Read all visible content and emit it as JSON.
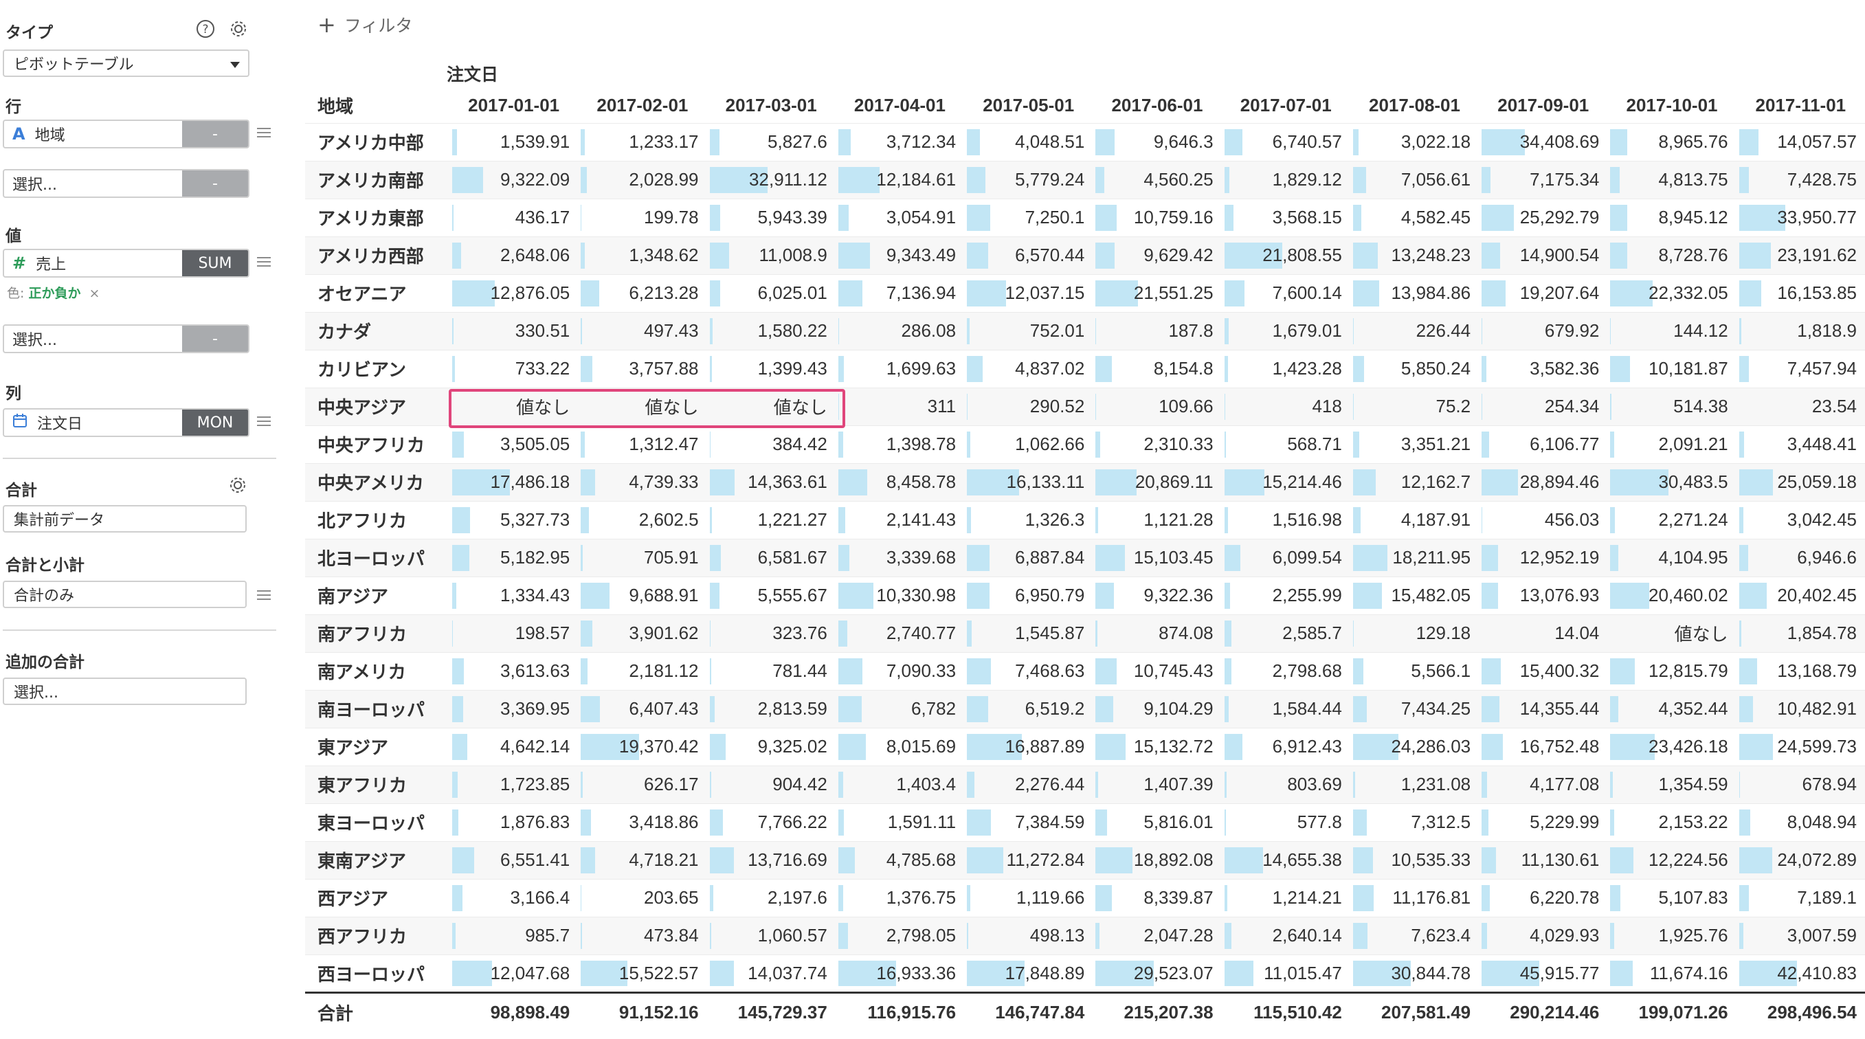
{
  "sidebar": {
    "type": {
      "title": "タイプ",
      "value": "ピボットテーブル"
    },
    "rows": {
      "title": "行",
      "field": "地域",
      "agg": "-",
      "select_placeholder": "選択...",
      "select_agg": "-"
    },
    "values": {
      "title": "値",
      "field": "売上",
      "agg": "SUM",
      "color_prefix": "色:",
      "color_value": "正か負か",
      "color_remove": "×",
      "select_placeholder": "選択...",
      "select_agg": "-"
    },
    "columns": {
      "title": "列",
      "field": "注文日",
      "agg": "MON"
    },
    "total": {
      "title": "合計",
      "value": "集計前データ"
    },
    "subtotal": {
      "title": "合計と小計",
      "value": "合計のみ"
    },
    "extra": {
      "title": "追加の合計",
      "placeholder": "選択..."
    }
  },
  "toolbar": {
    "filter_label": "フィルタ"
  },
  "pivot": {
    "column_group": "注文日",
    "row_header": "地域",
    "bar_color": "#c2e6f5",
    "highlight_color": "#e0457b",
    "columns": [
      "2017-01-01",
      "2017-02-01",
      "2017-03-01",
      "2017-04-01",
      "2017-05-01",
      "2017-06-01",
      "2017-07-01",
      "2017-08-01",
      "2017-09-01",
      "2017-10-01",
      "2017-11-01"
    ],
    "rows": [
      {
        "label": "アメリカ中部",
        "values": [
          "1,539.91",
          "1,233.17",
          "5,827.6",
          "3,712.34",
          "4,048.51",
          "9,646.3",
          "6,740.57",
          "3,022.18",
          "34,408.69",
          "8,965.76",
          "14,057.57"
        ]
      },
      {
        "label": "アメリカ南部",
        "values": [
          "9,322.09",
          "2,028.99",
          "32,911.12",
          "12,184.61",
          "5,779.24",
          "4,560.25",
          "1,829.12",
          "7,056.61",
          "7,175.34",
          "4,813.75",
          "7,428.75"
        ]
      },
      {
        "label": "アメリカ東部",
        "values": [
          "436.17",
          "199.78",
          "5,943.39",
          "3,054.91",
          "7,250.1",
          "10,759.16",
          "3,568.15",
          "4,582.45",
          "25,292.79",
          "8,945.12",
          "33,950.77"
        ]
      },
      {
        "label": "アメリカ西部",
        "values": [
          "2,648.06",
          "1,348.62",
          "11,008.9",
          "9,343.49",
          "6,570.44",
          "9,629.42",
          "21,808.55",
          "13,248.23",
          "14,900.54",
          "8,728.76",
          "23,191.62"
        ]
      },
      {
        "label": "オセアニア",
        "values": [
          "12,876.05",
          "6,213.28",
          "6,025.01",
          "7,136.94",
          "12,037.15",
          "21,551.25",
          "7,600.14",
          "13,984.86",
          "19,207.64",
          "22,332.05",
          "16,153.85"
        ]
      },
      {
        "label": "カナダ",
        "values": [
          "330.51",
          "497.43",
          "1,580.22",
          "286.08",
          "752.01",
          "187.8",
          "1,679.01",
          "226.44",
          "679.92",
          "144.12",
          "1,818.9"
        ]
      },
      {
        "label": "カリビアン",
        "values": [
          "733.22",
          "3,757.88",
          "1,399.43",
          "1,699.63",
          "4,837.02",
          "8,154.8",
          "1,423.28",
          "5,850.24",
          "3,582.36",
          "10,181.87",
          "7,457.94"
        ]
      },
      {
        "label": "中央アジア",
        "values": [
          "値なし",
          "値なし",
          "値なし",
          "311",
          "290.52",
          "109.66",
          "418",
          "75.2",
          "254.34",
          "514.38",
          "23.54"
        ]
      },
      {
        "label": "中央アフリカ",
        "values": [
          "3,505.05",
          "1,312.47",
          "384.42",
          "1,398.78",
          "1,062.66",
          "2,310.33",
          "568.71",
          "3,351.21",
          "6,106.77",
          "2,091.21",
          "3,448.41"
        ]
      },
      {
        "label": "中央アメリカ",
        "values": [
          "17,486.18",
          "4,739.33",
          "14,363.61",
          "8,458.78",
          "16,133.11",
          "20,869.11",
          "15,214.46",
          "12,162.7",
          "28,894.46",
          "30,483.5",
          "25,059.18"
        ]
      },
      {
        "label": "北アフリカ",
        "values": [
          "5,327.73",
          "2,602.5",
          "1,221.27",
          "2,141.43",
          "1,326.3",
          "1,121.28",
          "1,516.98",
          "4,187.91",
          "456.03",
          "2,271.24",
          "3,042.45"
        ]
      },
      {
        "label": "北ヨーロッパ",
        "values": [
          "5,182.95",
          "705.91",
          "6,581.67",
          "3,339.68",
          "6,887.84",
          "15,103.45",
          "6,099.54",
          "18,211.95",
          "12,952.19",
          "4,104.95",
          "6,946.6"
        ]
      },
      {
        "label": "南アジア",
        "values": [
          "1,334.43",
          "9,688.91",
          "5,555.67",
          "10,330.98",
          "6,950.79",
          "9,322.36",
          "2,255.99",
          "15,482.05",
          "13,076.93",
          "20,460.02",
          "20,402.45"
        ]
      },
      {
        "label": "南アフリカ",
        "values": [
          "198.57",
          "3,901.62",
          "323.76",
          "2,740.77",
          "1,545.87",
          "874.08",
          "2,585.7",
          "129.18",
          "14.04",
          "値なし",
          "1,854.78"
        ]
      },
      {
        "label": "南アメリカ",
        "values": [
          "3,613.63",
          "2,181.12",
          "781.44",
          "7,090.33",
          "7,468.63",
          "10,745.43",
          "2,798.68",
          "5,566.1",
          "15,400.32",
          "12,815.79",
          "13,168.79"
        ]
      },
      {
        "label": "南ヨーロッパ",
        "values": [
          "3,369.95",
          "6,407.43",
          "2,813.59",
          "6,782",
          "6,519.2",
          "9,104.29",
          "1,584.44",
          "7,434.25",
          "14,355.44",
          "4,352.44",
          "10,482.91"
        ]
      },
      {
        "label": "東アジア",
        "values": [
          "4,642.14",
          "19,370.42",
          "9,325.02",
          "8,015.69",
          "16,887.89",
          "15,132.72",
          "6,912.43",
          "24,286.03",
          "16,752.48",
          "23,426.18",
          "24,599.73"
        ]
      },
      {
        "label": "東アフリカ",
        "values": [
          "1,723.85",
          "626.17",
          "904.42",
          "1,403.4",
          "2,276.44",
          "1,407.39",
          "803.69",
          "1,231.08",
          "4,177.08",
          "1,354.59",
          "678.94"
        ]
      },
      {
        "label": "東ヨーロッパ",
        "values": [
          "1,876.83",
          "3,418.86",
          "7,766.22",
          "1,591.11",
          "7,384.59",
          "5,816.01",
          "577.8",
          "7,312.5",
          "5,229.99",
          "2,153.22",
          "8,048.94"
        ]
      },
      {
        "label": "東南アジア",
        "values": [
          "6,551.41",
          "4,718.21",
          "13,716.69",
          "4,785.68",
          "11,272.84",
          "18,892.08",
          "14,655.38",
          "10,535.33",
          "11,130.61",
          "12,224.56",
          "24,072.89"
        ]
      },
      {
        "label": "西アジア",
        "values": [
          "3,166.4",
          "203.65",
          "2,197.6",
          "1,376.75",
          "1,119.66",
          "8,339.87",
          "1,214.21",
          "11,176.81",
          "6,220.78",
          "5,107.83",
          "7,189.1"
        ]
      },
      {
        "label": "西アフリカ",
        "values": [
          "985.7",
          "473.84",
          "1,060.57",
          "2,798.05",
          "498.13",
          "2,047.28",
          "2,640.14",
          "7,623.4",
          "4,029.93",
          "1,925.76",
          "3,007.59"
        ]
      },
      {
        "label": "西ヨーロッパ",
        "values": [
          "12,047.68",
          "15,522.57",
          "14,037.74",
          "16,933.36",
          "17,848.89",
          "29,523.07",
          "11,015.47",
          "30,844.78",
          "45,915.77",
          "11,674.16",
          "42,410.83"
        ]
      }
    ],
    "total": {
      "label": "合計",
      "values": [
        "98,898.49",
        "91,152.16",
        "145,729.37",
        "116,915.76",
        "146,747.84",
        "215,207.38",
        "115,510.42",
        "207,581.49",
        "290,214.46",
        "199,071.26",
        "298,496.54"
      ]
    }
  }
}
